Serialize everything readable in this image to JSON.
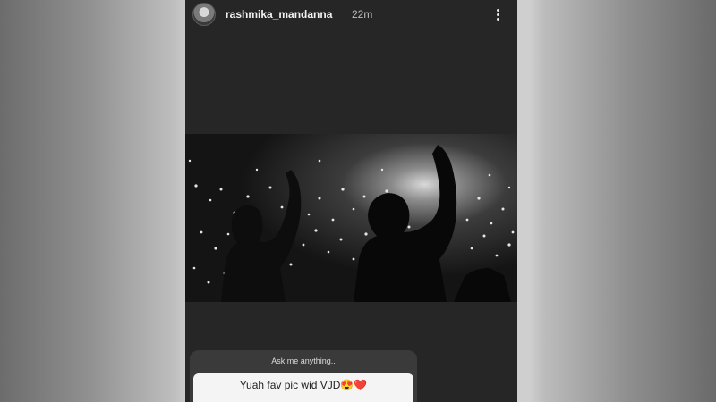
{
  "story": {
    "username": "rashmika_mandanna",
    "time": "22m",
    "more_icon": "more-vertical-icon",
    "question_sticker": {
      "prompt": "Ask me anything..",
      "answer": "Yuah fav pic wid VJD😍❤️"
    }
  }
}
